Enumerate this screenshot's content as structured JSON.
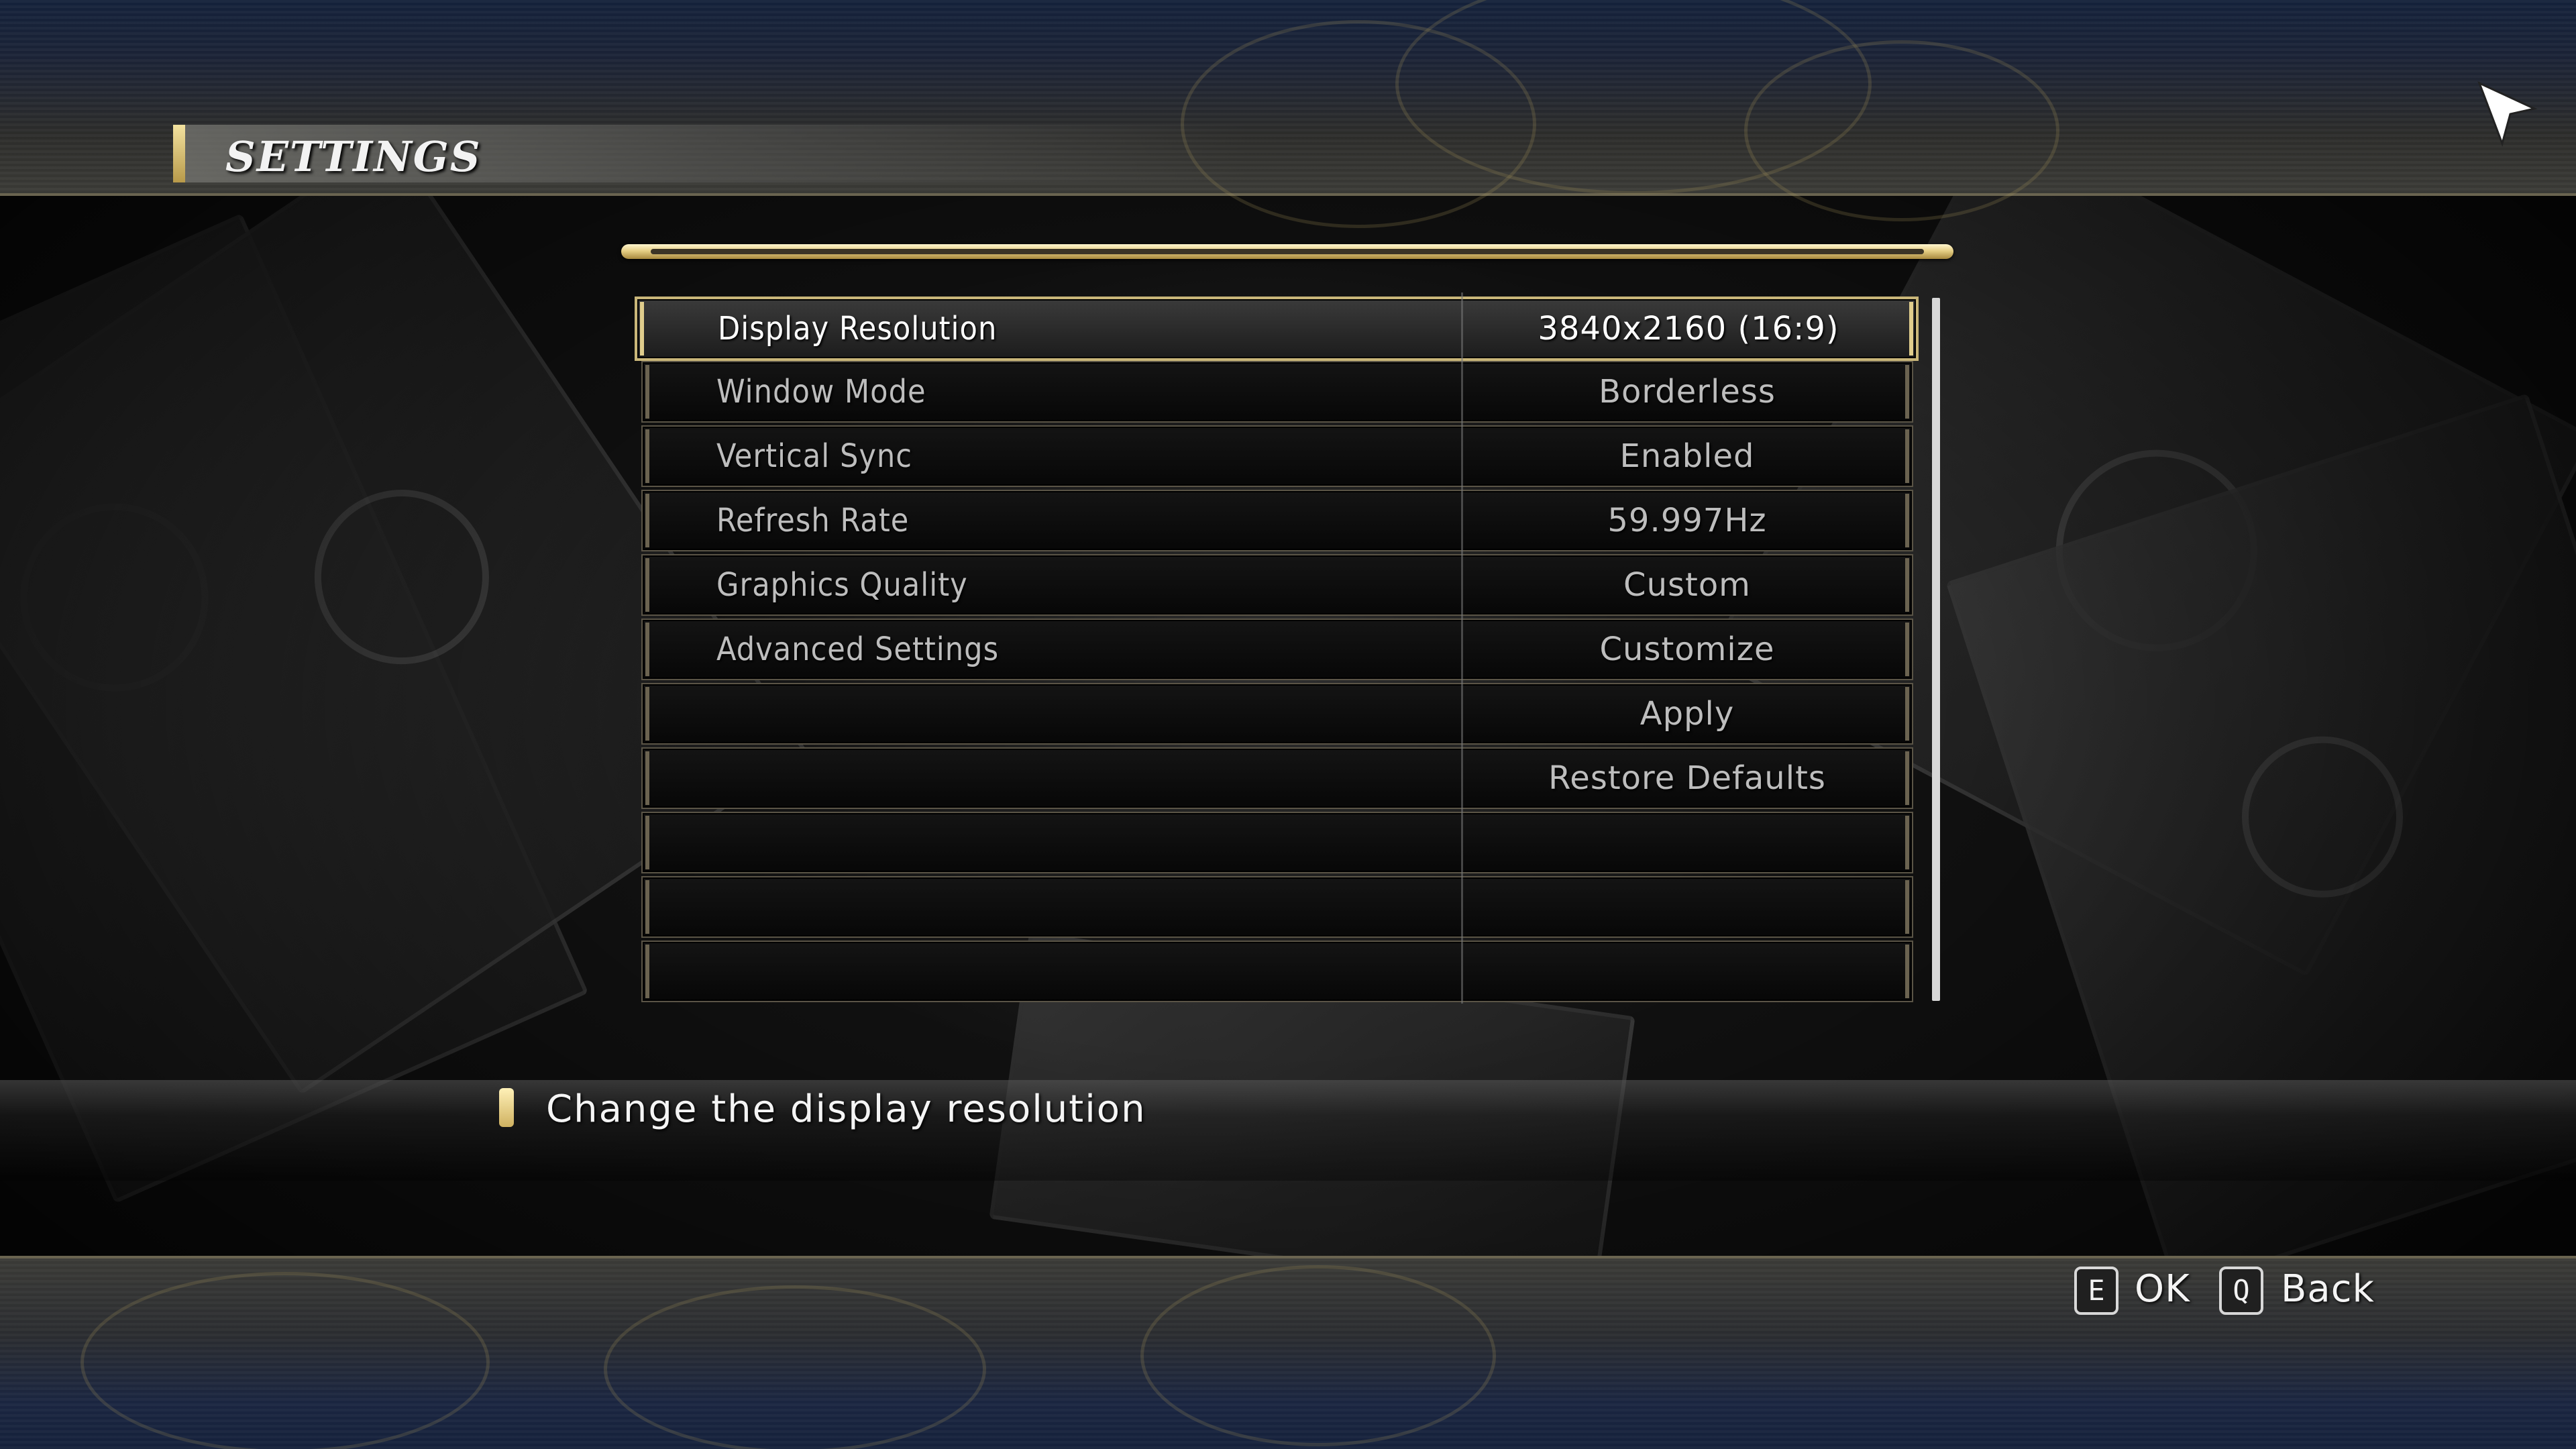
{
  "header": {
    "title": "SETTINGS"
  },
  "settings": {
    "rows": [
      {
        "label": "Display Resolution",
        "value": "3840x2160 (16:9)",
        "selected": true
      },
      {
        "label": "Window Mode",
        "value": "Borderless"
      },
      {
        "label": "Vertical Sync",
        "value": "Enabled"
      },
      {
        "label": "Refresh Rate",
        "value": "59.997Hz"
      },
      {
        "label": "Graphics Quality",
        "value": "Custom"
      },
      {
        "label": "Advanced Settings",
        "value": "Customize"
      },
      {
        "label": "",
        "value": "Apply"
      },
      {
        "label": "",
        "value": "Restore Defaults"
      },
      {
        "label": "",
        "value": ""
      },
      {
        "label": "",
        "value": ""
      },
      {
        "label": "",
        "value": ""
      }
    ]
  },
  "description": {
    "text": "Change the display resolution"
  },
  "controls": {
    "ok": {
      "key": "E",
      "label": "OK"
    },
    "back": {
      "key": "Q",
      "label": "Back"
    }
  },
  "icons": {
    "cursor": "mouse-pointer-icon",
    "description_marker": "bullet-marker-icon"
  },
  "colors": {
    "accent_gold": "#e0cd8c",
    "text_selected": "#ffffff",
    "text_normal": "#bdbdbd",
    "top_band": "#1a2236"
  }
}
